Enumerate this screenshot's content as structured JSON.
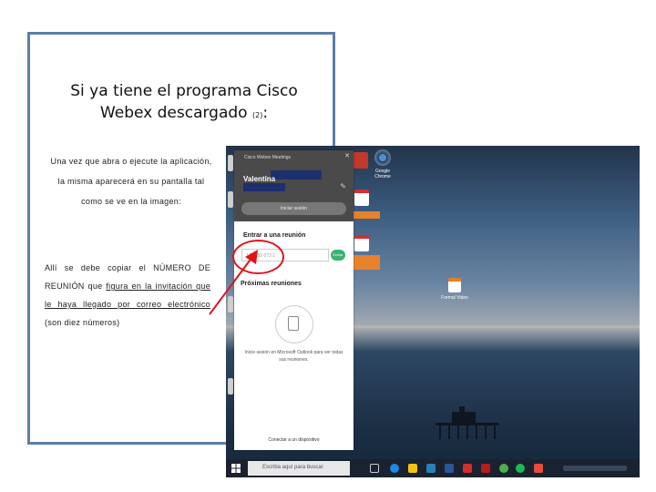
{
  "slide": {
    "title_line1": "Si ya tiene el programa Cisco",
    "title_line2": "Webex descargado",
    "title_note": "(2)",
    "title_colon": ":",
    "para1": "Una vez que abra o ejecute la aplicación, la misma aparecerá en su pantalla tal como se ve en la imagen:",
    "para2_a": "Allí se debe copiar el NÚMERO DE REUNIÓN que ",
    "para2_u1": "figura en la invitación que le haya llegado por correo electrónico",
    "para2_b": " (son diez números)"
  },
  "webex": {
    "app_title": "Cisco Webex Meetings",
    "close": "✕",
    "user_name": "Valentina",
    "signin_button": "Iniciar sesión",
    "join_title": "Entrar a una reunión",
    "meeting_input_value": "147 155 073 1",
    "go_button": "Entrar",
    "upcoming_title": "Próximas reuniones",
    "outlook_text": "Inicie sesión en Microsoft Outlook para ver todas sus reuniones.",
    "device_text": "Conectar a un dispositivo"
  },
  "taskbar": {
    "search_placeholder": "Escriba aquí para buscar"
  },
  "desktop": {
    "icon_label_1": "Google Chrome",
    "icon_label_2": "Formal Video"
  },
  "colors": {
    "slide_border": "#5b7fa6",
    "highlight": "#e0141b",
    "webex_header": "#4a4a4a",
    "join_button": "#3cb371"
  }
}
